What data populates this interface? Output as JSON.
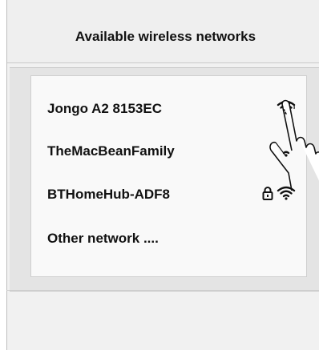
{
  "header": {
    "title": "Available wireless networks"
  },
  "networks": [
    {
      "name": "Jongo A2 8153EC",
      "signal_icon": "wifi-full-icon",
      "locked": false
    },
    {
      "name": "TheMacBeanFamily",
      "signal_icon": "wifi-weak-icon",
      "locked": false
    },
    {
      "name": "BTHomeHub-ADF8",
      "signal_icon": "wifi-full-icon",
      "locked": true
    },
    {
      "name": "Other network ....",
      "signal_icon": null,
      "locked": false
    }
  ],
  "colors": {
    "panel_bg": "#e4e4e4",
    "list_bg": "#f9f9f9",
    "text": "#111111"
  }
}
